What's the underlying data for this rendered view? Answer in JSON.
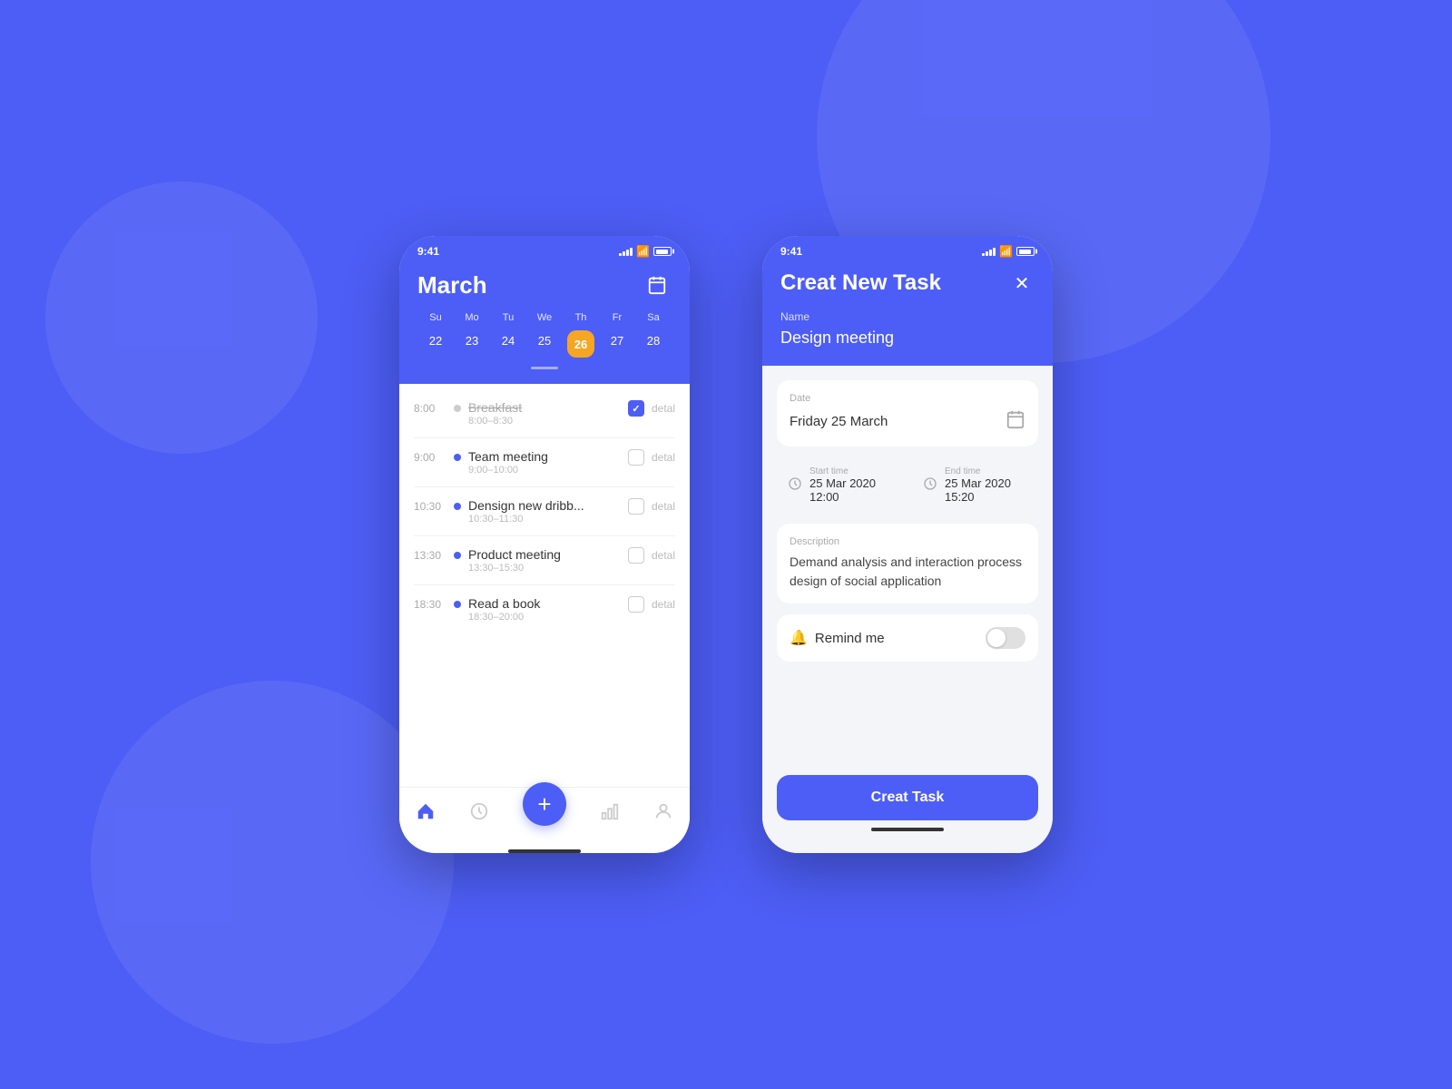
{
  "background": "#4d5ef6",
  "phone1": {
    "status_time": "9:41",
    "header": {
      "month": "March"
    },
    "week_days": [
      "Su",
      "Mo",
      "Tu",
      "We",
      "Th",
      "Fr",
      "Sa"
    ],
    "week_dates": [
      "22",
      "23",
      "24",
      "25",
      "26",
      "27",
      "28"
    ],
    "active_date": "26",
    "schedule": [
      {
        "time": "8:00",
        "title": "Breakfast",
        "sub": "8:00–8:30",
        "done": true,
        "dot": "grey"
      },
      {
        "time": "9:00",
        "title": "Team meeting",
        "sub": "9:00–10:00",
        "done": false,
        "dot": "blue"
      },
      {
        "time": "10:30",
        "title": "Densign new dribb...",
        "sub": "10:30–11:30",
        "done": false,
        "dot": "blue"
      },
      {
        "time": "13:30",
        "title": "Product meeting",
        "sub": "13:30–15:30",
        "done": false,
        "dot": "blue"
      },
      {
        "time": "18:30",
        "title": "Read a book",
        "sub": "18:30–20:00",
        "done": false,
        "dot": "blue"
      }
    ],
    "nav": {
      "home": "home",
      "clock": "clock",
      "chart": "chart",
      "user": "user"
    }
  },
  "phone2": {
    "status_time": "9:41",
    "title": "Creat New Task",
    "name_label": "Name",
    "name_value": "Design meeting",
    "date_label": "Date",
    "date_value": "Friday 25 March",
    "start_time_label": "Start time",
    "start_time_value": "25 Mar 2020  12:00",
    "end_time_label": "End time",
    "end_time_value": "25 Mar 2020  15:20",
    "description_label": "Description",
    "description_value": "Demand analysis and interaction process design of social application",
    "remind_label": "Remind me",
    "create_task_btn": "Creat Task"
  }
}
